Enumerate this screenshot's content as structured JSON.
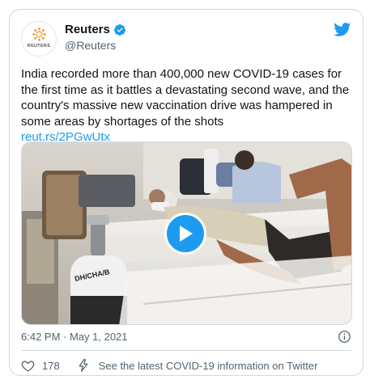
{
  "account": {
    "name": "Reuters",
    "handle": "@Reuters",
    "logo_wordmark": "REUTERS"
  },
  "tweet": {
    "text": "India recorded more than 400,000 new COVID-19 cases for the first time as it battles a devastating second wave, and the country's massive new vaccination drive was hampered in some areas by shortages of the shots",
    "link": "reut.rs/2PGwUtx"
  },
  "media": {
    "type": "video",
    "cylinder_label": "DH/CHA/B"
  },
  "timestamp": "6:42 PM · May 1, 2021",
  "engagement": {
    "like_count": "178",
    "covid_info": "See the latest COVID-19 information on Twitter"
  },
  "colors": {
    "accent": "#1d9bf0",
    "text": "#0f1419",
    "secondary": "#536471",
    "border": "#cfd9de"
  },
  "icons": [
    "reuters-logo",
    "verified-badge-icon",
    "twitter-bird-icon",
    "play-icon",
    "info-icon",
    "heart-icon",
    "lightning-icon"
  ]
}
